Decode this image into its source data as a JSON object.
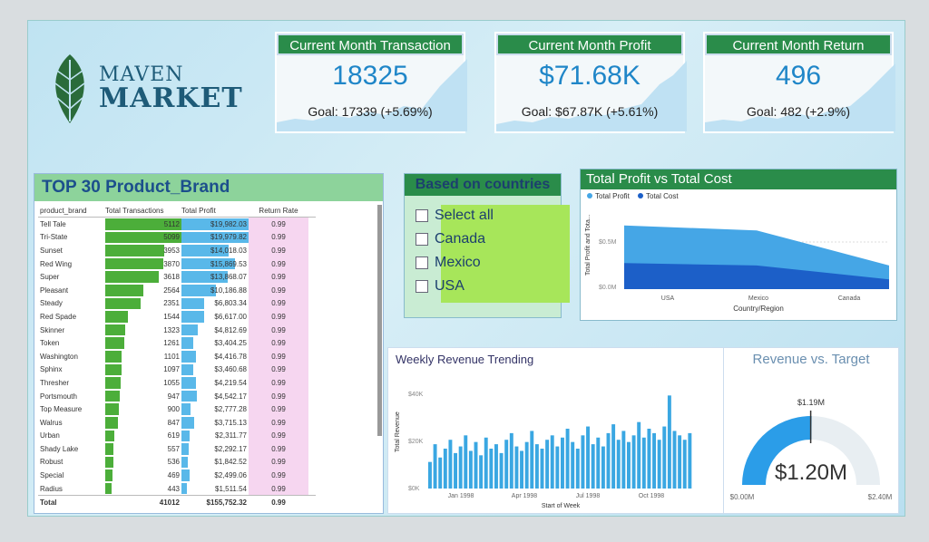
{
  "logo": {
    "line1": "MAVEN",
    "line2": "MARKET"
  },
  "kpis": [
    {
      "title": "Current Month Transaction",
      "value": "18325",
      "goal": "Goal: 17339 (+5.69%)"
    },
    {
      "title": "Current Month Profit",
      "value": "$71.68K",
      "goal": "Goal: $67.87K (+5.61%)"
    },
    {
      "title": "Current Month Return",
      "value": "496",
      "goal": "Goal: 482 (+2.9%)"
    }
  ],
  "brands": {
    "title": "TOP 30 Product_Brand",
    "headers": [
      "product_brand",
      "Total Transactions",
      "Total Profit",
      "Return Rate"
    ],
    "rows": [
      {
        "brand": "Tell Tale",
        "tx": "5112",
        "profit": "$19,982.03",
        "rate": "0.99"
      },
      {
        "brand": "Tri-State",
        "tx": "5099",
        "profit": "$19,979.82",
        "rate": "0.99"
      },
      {
        "brand": "Sunset",
        "tx": "3953",
        "profit": "$14,018.03",
        "rate": "0.99"
      },
      {
        "brand": "Red Wing",
        "tx": "3870",
        "profit": "$15,869.53",
        "rate": "0.99"
      },
      {
        "brand": "Super",
        "tx": "3618",
        "profit": "$13,868.07",
        "rate": "0.99"
      },
      {
        "brand": "Pleasant",
        "tx": "2564",
        "profit": "$10,186.88",
        "rate": "0.99"
      },
      {
        "brand": "Steady",
        "tx": "2351",
        "profit": "$6,803.34",
        "rate": "0.99"
      },
      {
        "brand": "Red Spade",
        "tx": "1544",
        "profit": "$6,617.00",
        "rate": "0.99"
      },
      {
        "brand": "Skinner",
        "tx": "1323",
        "profit": "$4,812.69",
        "rate": "0.99"
      },
      {
        "brand": "Token",
        "tx": "1261",
        "profit": "$3,404.25",
        "rate": "0.99"
      },
      {
        "brand": "Washington",
        "tx": "1101",
        "profit": "$4,416.78",
        "rate": "0.99"
      },
      {
        "brand": "Sphinx",
        "tx": "1097",
        "profit": "$3,460.68",
        "rate": "0.99"
      },
      {
        "brand": "Thresher",
        "tx": "1055",
        "profit": "$4,219.54",
        "rate": "0.99"
      },
      {
        "brand": "Portsmouth",
        "tx": "947",
        "profit": "$4,542.17",
        "rate": "0.99"
      },
      {
        "brand": "Top Measure",
        "tx": "900",
        "profit": "$2,777.28",
        "rate": "0.99"
      },
      {
        "brand": "Walrus",
        "tx": "847",
        "profit": "$3,715.13",
        "rate": "0.99"
      },
      {
        "brand": "Urban",
        "tx": "619",
        "profit": "$2,311.77",
        "rate": "0.99"
      },
      {
        "brand": "Shady Lake",
        "tx": "557",
        "profit": "$2,292.17",
        "rate": "0.99"
      },
      {
        "brand": "Robust",
        "tx": "536",
        "profit": "$1,842.52",
        "rate": "0.99"
      },
      {
        "brand": "Special",
        "tx": "469",
        "profit": "$2,499.06",
        "rate": "0.99"
      },
      {
        "brand": "Radius",
        "tx": "443",
        "profit": "$1,511.54",
        "rate": "0.99"
      }
    ],
    "total": {
      "label": "Total",
      "tx": "41012",
      "profit": "$155,752.32",
      "rate": "0.99"
    }
  },
  "filter": {
    "title": "Based on countries",
    "options": [
      "Select all",
      "Canada",
      "Mexico",
      "USA"
    ]
  },
  "profit_chart": {
    "title": "Total Profit vs Total Cost",
    "legend": [
      "Total Profit",
      "Total Cost"
    ],
    "ylabel": "Total Profit and Tota...",
    "yticks": [
      "$0.5M",
      "$0.0M"
    ],
    "categories": [
      "USA",
      "Mexico",
      "Canada"
    ],
    "xlabel": "Country/Region",
    "colors": {
      "profit": "#45a6e6",
      "cost": "#1c5fc8"
    }
  },
  "weekly": {
    "title": "Weekly Revenue Trending",
    "ylabel": "Total Revenue",
    "yticks": [
      "$40K",
      "$20K",
      "$0K"
    ],
    "xticks": [
      "Jan 1998",
      "Apr 1998",
      "Jul 1998",
      "Oct 1998"
    ],
    "xlabel": "Start of Week",
    "bar_color": "#3aa7e2"
  },
  "target": {
    "title": "Revenue vs. Target",
    "target_label": "$1.19M",
    "value_label": "$1.20M",
    "min_label": "$0.00M",
    "max_label": "$2.40M"
  },
  "chart_data": [
    {
      "type": "area",
      "title": "Total Profit vs Total Cost",
      "categories": [
        "USA",
        "Mexico",
        "Canada"
      ],
      "series": [
        {
          "name": "Total Profit",
          "values": [
            0.78,
            0.72,
            0.29
          ]
        },
        {
          "name": "Total Cost",
          "values": [
            0.32,
            0.29,
            0.12
          ]
        }
      ],
      "xlabel": "Country/Region",
      "ylabel": "Total Profit and Tota...",
      "ylim": [
        0,
        1.0
      ]
    },
    {
      "type": "bar",
      "title": "Weekly Revenue Trending",
      "xlabel": "Start of Week",
      "ylabel": "Total Revenue",
      "ylim": [
        0,
        45
      ],
      "values": [
        12,
        20,
        14,
        18,
        22,
        16,
        19,
        24,
        17,
        21,
        15,
        23,
        18,
        20,
        16,
        22,
        25,
        19,
        17,
        21,
        26,
        20,
        18,
        22,
        24,
        19,
        23,
        27,
        21,
        18,
        24,
        28,
        20,
        23,
        19,
        25,
        29,
        22,
        26,
        21,
        24,
        30,
        23,
        27,
        25,
        22,
        28,
        42,
        26,
        24,
        22,
        25
      ]
    }
  ]
}
